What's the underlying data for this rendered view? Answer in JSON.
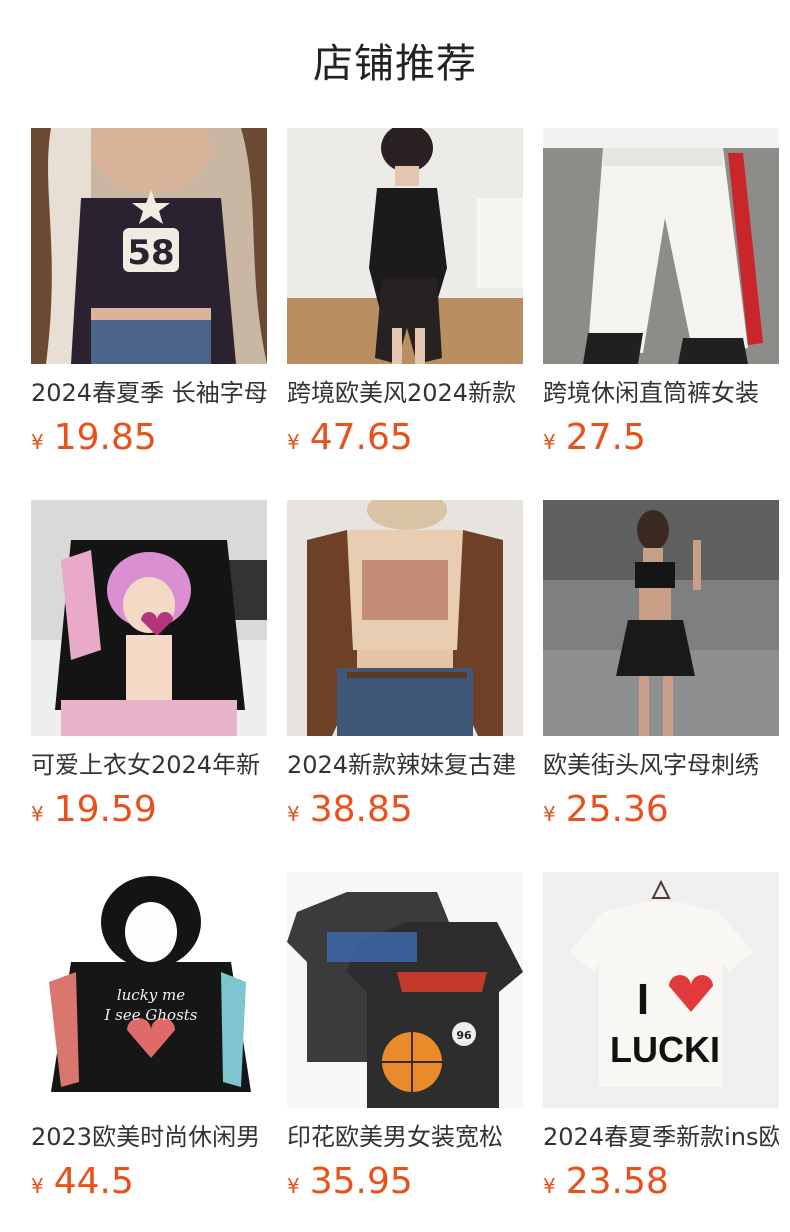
{
  "section": {
    "title": "店铺推荐"
  },
  "currency_symbol": "¥",
  "colors": {
    "price": "#e8501c",
    "title": "#222222",
    "text": "#333333"
  },
  "products": [
    {
      "name": "2024春夏季 长袖字母",
      "price": "19.85",
      "image_icon": "cropped-top-58-photo"
    },
    {
      "name": "跨境欧美风2024新款",
      "price": "47.65",
      "image_icon": "black-halter-dress-photo"
    },
    {
      "name": "跨境休闲直筒裤女装",
      "price": "27.5",
      "image_icon": "white-track-pants-photo"
    },
    {
      "name": "可爱上衣女2024年新",
      "price": "19.59",
      "image_icon": "anime-print-tee-photo"
    },
    {
      "name": "2024新款辣妹复古建",
      "price": "38.85",
      "image_icon": "raglan-crop-top-photo"
    },
    {
      "name": "欧美街头风字母刺绣",
      "price": "25.36",
      "image_icon": "crop-top-skirt-set-photo"
    },
    {
      "name": "2023欧美时尚休闲男",
      "price": "44.5",
      "image_icon": "black-hoodie-photo"
    },
    {
      "name": "印花欧美男女装宽松",
      "price": "35.95",
      "image_icon": "basketball-print-tee-photo"
    },
    {
      "name": "2024春夏季新款ins欧",
      "price": "23.58",
      "image_icon": "i-love-lucki-tee-photo"
    }
  ]
}
